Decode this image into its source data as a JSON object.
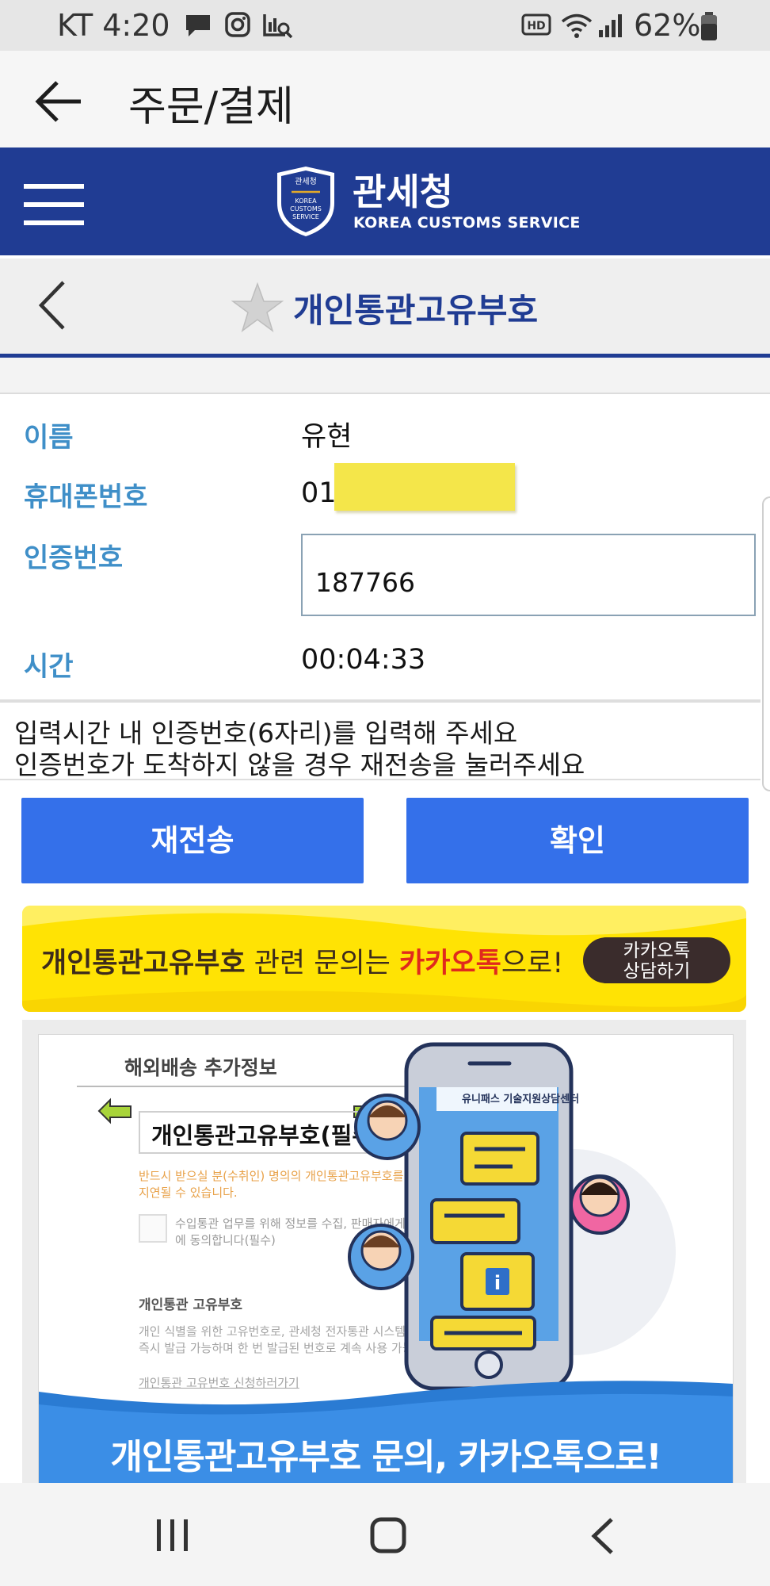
{
  "status_bar": {
    "carrier_time": "KT 4:20",
    "battery": "62%"
  },
  "app_bar": {
    "title": "주문/결제"
  },
  "customs_header": {
    "name": "관세청",
    "subtitle": "KOREA CUSTOMS SERVICE",
    "emblem_text": "관세청"
  },
  "page_header": {
    "title": "개인통관고유부호"
  },
  "form": {
    "name_label": "이름",
    "name_value": "유현",
    "phone_label": "휴대폰번호",
    "phone_value": "01",
    "auth_label": "인증번호",
    "auth_value": "187766",
    "time_label": "시간",
    "time_value": "00:04:33"
  },
  "notice": {
    "line1": "입력시간 내 인증번호(6자리)를 입력해 주세요",
    "line2": "인증번호가 도착하지 않을 경우 재전송을 눌러주세요"
  },
  "buttons": {
    "resend": "재전송",
    "confirm": "확인"
  },
  "kakao_banner": {
    "part1": "개인통관고유부호",
    "part2": " 관련 문의는 ",
    "part3": "카카오톡",
    "part4": "으로!",
    "pill_line1": "카카오톡",
    "pill_line2": "상담하기"
  },
  "promo": {
    "section_title": "해외배송 추가정보",
    "field_title": "개인통관고유부호(필수)",
    "warning": "반드시 받으실 분(수취인) 명의의 개인통관고유부호를 시 통관이 지연될 수 있습니다.",
    "consent": "수입통관 업무를 위해 정보를 수집, 판매자에게 제공하 저장함에 동의합니다(필수)",
    "sub_title": "개인통관 고유부호",
    "desc": "개인 식별을 위한 고유번호로, 관세청 전자통관 시스템에서 신청 즉시 발급 가능하며 한 번 발급된 번호로 계속 사용 가능",
    "link": "개인통관 고유번호 신청하러가기",
    "phone_header": "유니패스 기술지원상담센터",
    "bottom_banner": "개인통관고유부호 문의, 카카오톡으로!"
  },
  "colors": {
    "customs_blue": "#203c93",
    "button_blue": "#3470ea",
    "label_blue": "#3f8fc8",
    "kakao_yellow": "#ffe304",
    "highlight_yellow": "#f4e64a"
  }
}
